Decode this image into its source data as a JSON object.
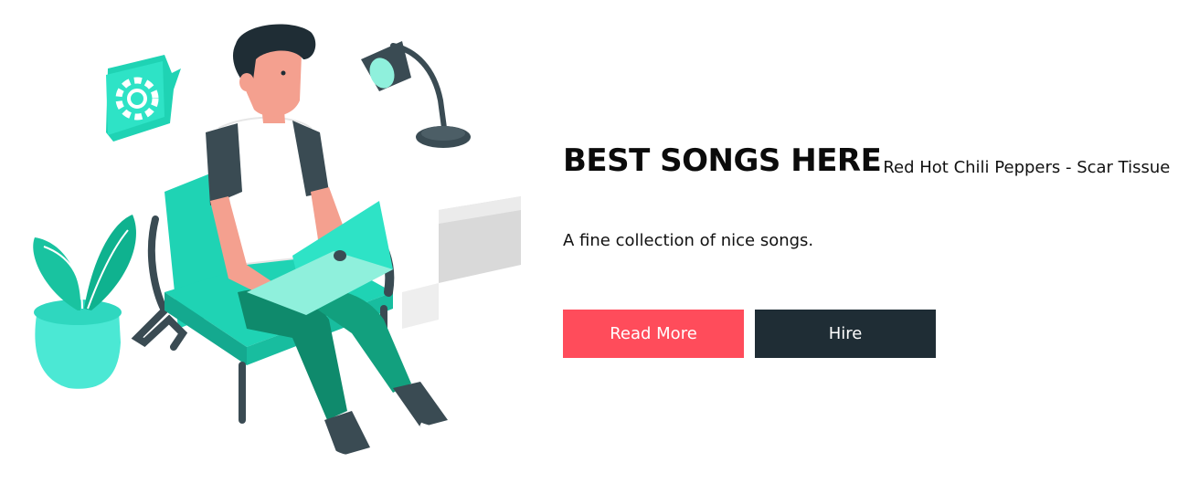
{
  "hero": {
    "title": "BEST SONGS HERE",
    "now_playing": "Red Hot Chili Peppers - Scar Tissue",
    "subtitle": "A fine collection of nice songs.",
    "buttons": {
      "read_more_label": "Read More",
      "hire_label": "Hire"
    }
  },
  "illustration": {
    "icons": [
      "gear-icon",
      "lamp-icon",
      "plant-icon",
      "laptop-icon",
      "armchair-icon"
    ]
  },
  "colors": {
    "accent": "#ff4c5b",
    "dark": "#1f2d35",
    "teal": "#1fd3b4",
    "teal_dark": "#0f8a6c",
    "skin": "#f4a08f",
    "charcoal": "#3a4b53"
  }
}
